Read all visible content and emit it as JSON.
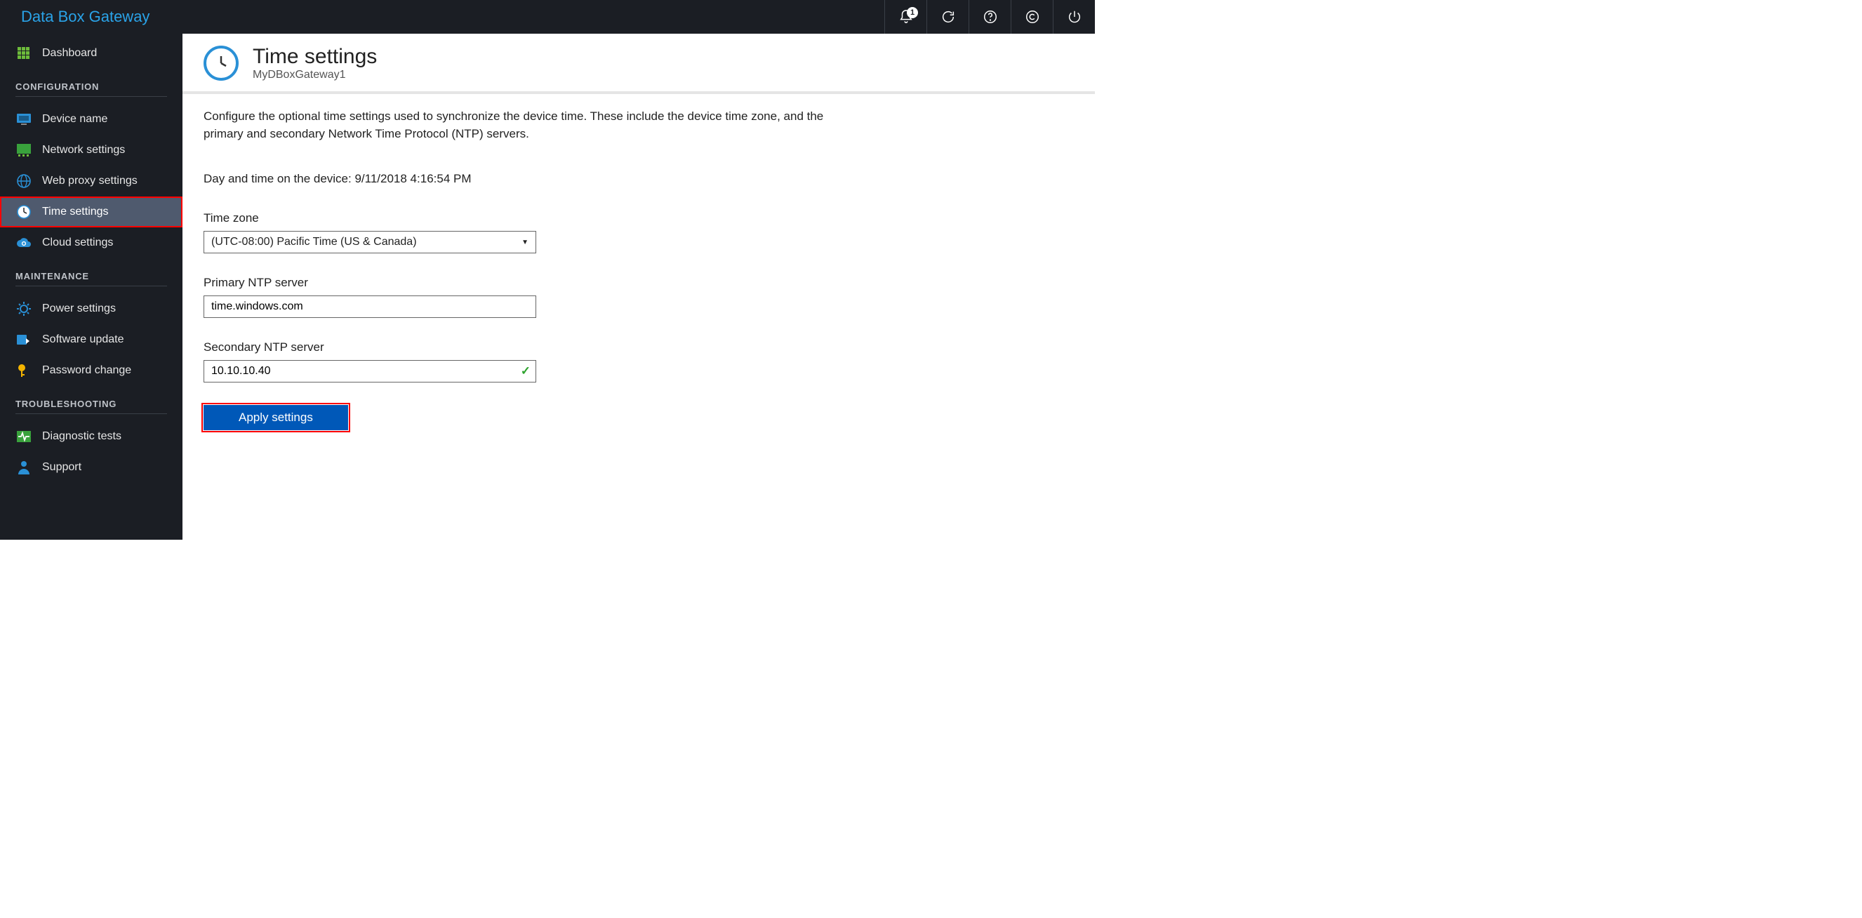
{
  "app": {
    "title": "Data Box Gateway"
  },
  "topbar": {
    "notification_count": "1"
  },
  "sidebar": {
    "dashboard_label": "Dashboard",
    "section_config": "CONFIGURATION",
    "device_name_label": "Device name",
    "network_settings_label": "Network settings",
    "web_proxy_label": "Web proxy settings",
    "time_settings_label": "Time settings",
    "cloud_settings_label": "Cloud settings",
    "section_maintenance": "MAINTENANCE",
    "power_settings_label": "Power settings",
    "software_update_label": "Software update",
    "password_change_label": "Password change",
    "section_troubleshoot": "TROUBLESHOOTING",
    "diagnostic_tests_label": "Diagnostic tests",
    "support_label": "Support"
  },
  "page": {
    "title": "Time settings",
    "subtitle": "MyDBoxGateway1",
    "description": "Configure the optional time settings used to synchronize the device time. These include the device time zone, and the primary and secondary Network Time Protocol (NTP) servers.",
    "devicetime_prefix": "Day and time on the device: ",
    "devicetime_value": "9/11/2018 4:16:54 PM",
    "tz_label": "Time zone",
    "tz_value": "(UTC-08:00) Pacific Time (US & Canada)",
    "primary_label": "Primary NTP server",
    "primary_value": "time.windows.com",
    "secondary_label": "Secondary NTP server",
    "secondary_value": "10.10.10.40",
    "apply_button": "Apply settings"
  }
}
